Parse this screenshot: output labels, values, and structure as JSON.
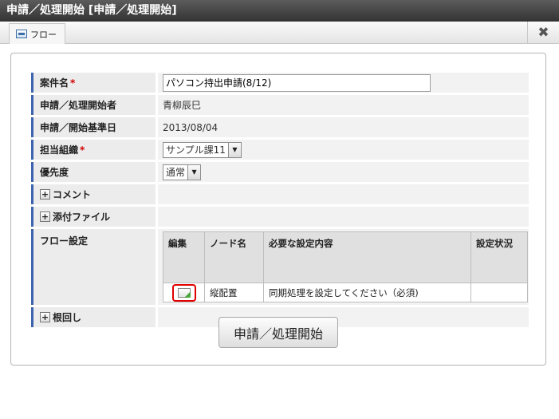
{
  "window": {
    "title": "申請／処理開始 [申請／処理開始]"
  },
  "tabs": [
    {
      "label": "フロー",
      "icon": "window-icon"
    }
  ],
  "close_label": "✖",
  "form": {
    "case_name": {
      "label": "案件名",
      "required_mark": "*",
      "value": "パソコン持出申請(8/12)"
    },
    "applicant": {
      "label": "申請／処理開始者",
      "value": "青柳辰巳"
    },
    "base_date": {
      "label": "申請／開始基準日",
      "value": "2013/08/04"
    },
    "org": {
      "label": "担当組織",
      "required_mark": "*",
      "selected": "サンプル課11"
    },
    "priority": {
      "label": "優先度",
      "selected": "通常"
    },
    "comment": {
      "label": "コメント",
      "toggle": "+"
    },
    "attachment": {
      "label": "添付ファイル",
      "toggle": "+"
    },
    "flow_settings": {
      "label": "フロー設定",
      "columns": [
        "編集",
        "ノード名",
        "必要な設定内容",
        "設定状況"
      ],
      "rows": [
        {
          "node": "縦配置",
          "required": "同期処理を設定してください（必須)",
          "status": ""
        }
      ]
    },
    "negotiation": {
      "label": "根回し",
      "toggle": "+"
    }
  },
  "submit_label": "申請／処理開始"
}
